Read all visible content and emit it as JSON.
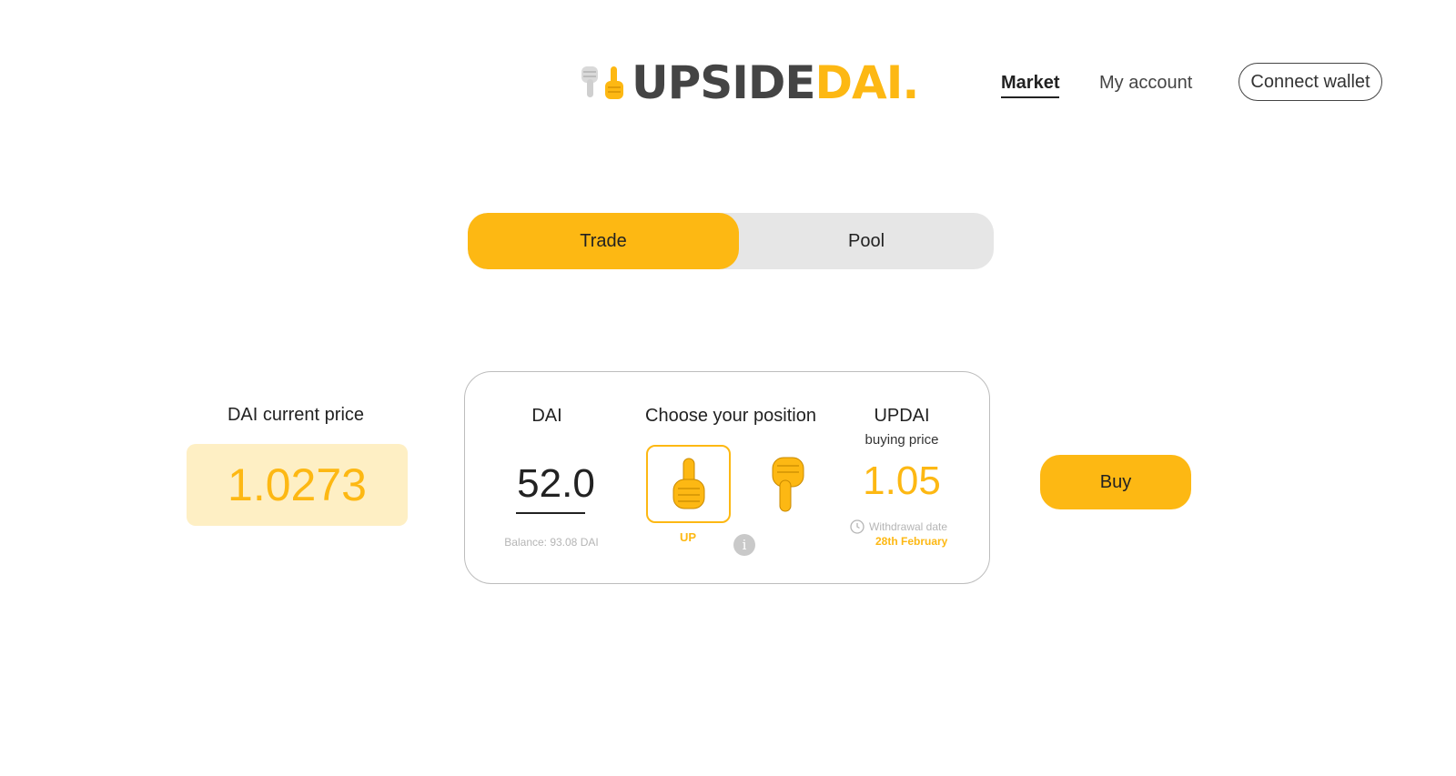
{
  "brand": {
    "name_part1": "UPSIDE",
    "name_part2": "DAI.",
    "accent_color": "#FDB813",
    "dark_color": "#444444",
    "logo_icons": [
      "pointing-down-hand-icon",
      "pointing-up-hand-icon"
    ]
  },
  "nav": {
    "market": "Market",
    "my_account": "My account",
    "connect_wallet": "Connect wallet"
  },
  "tabs": {
    "trade": "Trade",
    "pool": "Pool",
    "active": "Trade"
  },
  "current_price": {
    "label": "DAI current price",
    "value": "1.0273"
  },
  "trade_card": {
    "dai_label": "DAI",
    "amount": "52.0",
    "balance": "Balance: 93.08 DAI",
    "position_label": "Choose your position",
    "selected_position": "UP",
    "up_label": "UP",
    "token_label": "UPDAI",
    "token_sub": "buying price",
    "buying_price": "1.05",
    "withdrawal_label": "Withdrawal date",
    "withdrawal_date": "28th February",
    "info": "i"
  },
  "actions": {
    "buy": "Buy"
  }
}
